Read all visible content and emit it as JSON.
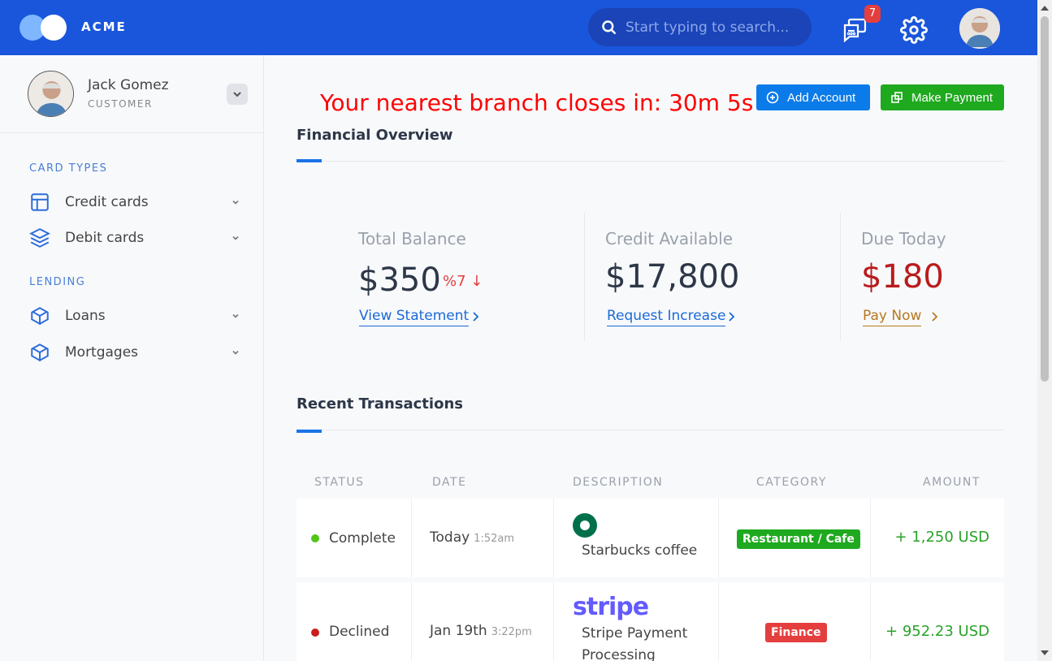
{
  "header": {
    "brand": "ACME",
    "search_placeholder": "Start typing to search...",
    "notification_count": "7"
  },
  "sidebar": {
    "user": {
      "name": "Jack Gomez",
      "role": "CUSTOMER"
    },
    "sections": [
      {
        "title": "CARD TYPES",
        "items": [
          {
            "label": "Credit cards",
            "icon": "layout-icon"
          },
          {
            "label": "Debit cards",
            "icon": "layers-icon"
          }
        ]
      },
      {
        "title": "LENDING",
        "items": [
          {
            "label": "Loans",
            "icon": "box-icon"
          },
          {
            "label": "Mortgages",
            "icon": "box-icon"
          }
        ]
      }
    ]
  },
  "main": {
    "countdown": "Your nearest branch closes in: 30m 5s",
    "buttons": {
      "add_account": "Add Account",
      "make_payment": "Make Payment"
    },
    "overview": {
      "title": "Financial Overview",
      "stats": [
        {
          "label": "Total Balance",
          "value": "$350",
          "delta": "%7",
          "link": "View Statement"
        },
        {
          "label": "Credit Available",
          "value": "$17,800",
          "link": "Request Increase"
        },
        {
          "label": "Due Today",
          "value": "$180",
          "link": "Pay Now"
        }
      ]
    },
    "transactions": {
      "title": "Recent Transactions",
      "columns": [
        "STATUS",
        "DATE",
        "DESCRIPTION",
        "CATEGORY",
        "AMOUNT"
      ],
      "rows": [
        {
          "status": "Complete",
          "date": "Today",
          "time": "1:52am",
          "description": "Starbucks coffee",
          "category": "Restaurant / Cafe",
          "amount": "+ 1,250 USD"
        },
        {
          "status": "Declined",
          "date": "Jan 19th",
          "time": "3:22pm",
          "logo_text": "stripe",
          "description_line1": "Stripe Payment",
          "description_line2": "Processing",
          "category": "Finance",
          "amount": "+ 952.23 USD"
        }
      ]
    }
  },
  "colors": {
    "header": "#1a56db",
    "accent": "#1a73e8",
    "danger": "#e53e3e",
    "success": "#1fa91f",
    "due": "#b91c1c",
    "pay_link": "#b7791f"
  }
}
